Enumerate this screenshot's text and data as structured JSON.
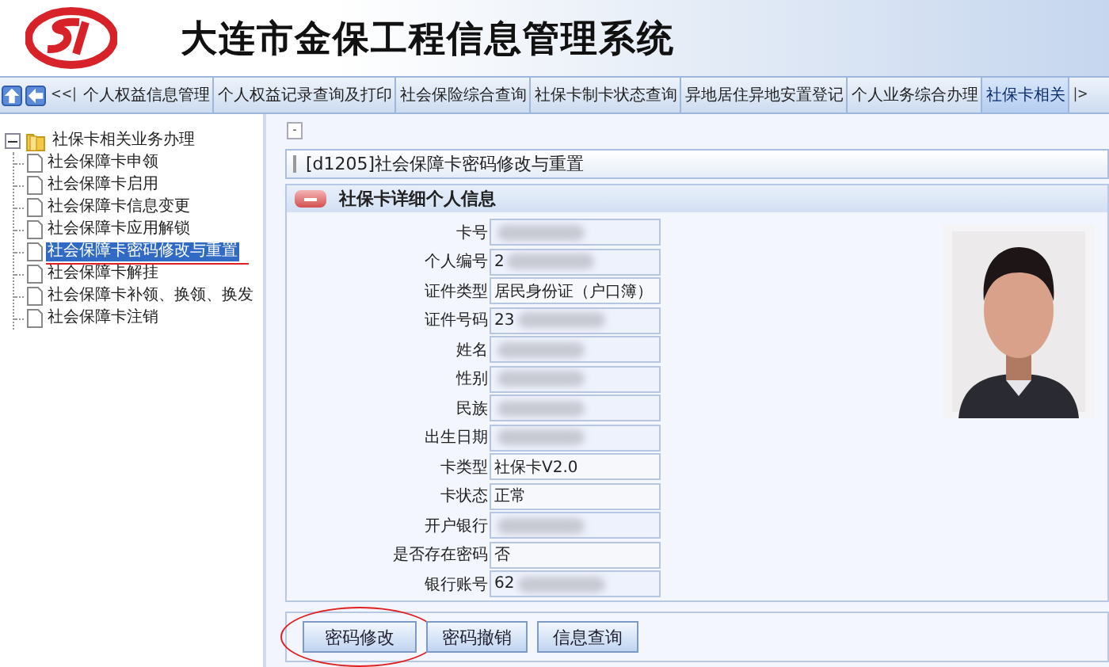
{
  "header": {
    "title": "大连市金保工程信息管理系统"
  },
  "tab_bar": {
    "prev": "<<|",
    "next": "|>",
    "tabs": [
      {
        "label": "个人权益信息管理",
        "selected": false
      },
      {
        "label": "个人权益记录查询及打印",
        "selected": false
      },
      {
        "label": "社会保险综合查询",
        "selected": false
      },
      {
        "label": "社保卡制卡状态查询",
        "selected": false
      },
      {
        "label": "异地居住异地安置登记",
        "selected": false
      },
      {
        "label": "个人业务综合办理",
        "selected": false
      },
      {
        "label": "社保卡相关",
        "selected": true
      }
    ]
  },
  "sidebar": {
    "root": {
      "label": "社保卡相关业务办理",
      "expanded": true,
      "children": [
        {
          "label": "社会保障卡申领",
          "selected": false
        },
        {
          "label": "社会保障卡启用",
          "selected": false
        },
        {
          "label": "社会保障卡信息变更",
          "selected": false
        },
        {
          "label": "社会保障卡应用解锁",
          "selected": false
        },
        {
          "label": "社会保障卡密码修改与重置",
          "selected": true
        },
        {
          "label": "社会保障卡解挂",
          "selected": false
        },
        {
          "label": "社会保障卡补领、换领、换发",
          "selected": false
        },
        {
          "label": "社会保障卡注销",
          "selected": false
        }
      ]
    }
  },
  "panel": {
    "collapse_marker": "-",
    "title": "[d1205]社会保障卡密码修改与重置",
    "section": "社保卡详细个人信息",
    "fields": [
      {
        "label": "卡号",
        "redacted": true
      },
      {
        "label": "个人编号",
        "value": "2",
        "redacted": true
      },
      {
        "label": "证件类型",
        "value": "居民身份证（户口簿）",
        "redacted": false
      },
      {
        "label": "证件号码",
        "value": "23",
        "redacted": true
      },
      {
        "label": "姓名",
        "redacted": true
      },
      {
        "label": "性别",
        "redacted": true
      },
      {
        "label": "民族",
        "redacted": true
      },
      {
        "label": "出生日期",
        "redacted": true
      },
      {
        "label": "卡类型",
        "value": "社保卡V2.0",
        "redacted": false
      },
      {
        "label": "卡状态",
        "value": "正常",
        "redacted": false
      },
      {
        "label": "开户银行",
        "redacted": true
      },
      {
        "label": "是否存在密码",
        "value": "否",
        "redacted": false
      },
      {
        "label": "银行账号",
        "value": "62",
        "redacted": true
      }
    ],
    "buttons": [
      {
        "label": "密码修改",
        "circled": true
      },
      {
        "label": "密码撤销",
        "circled": false
      },
      {
        "label": "信息查询",
        "circled": false
      }
    ]
  }
}
